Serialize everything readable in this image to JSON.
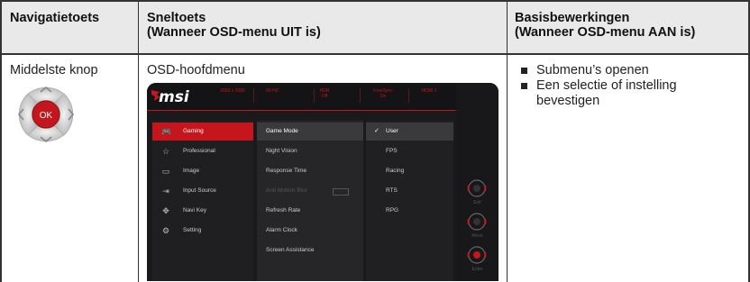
{
  "table": {
    "headers": [
      {
        "line1": "Navigatietoets",
        "line2": ""
      },
      {
        "line1": "Sneltoets",
        "line2": "(Wanneer OSD-menu UIT is)"
      },
      {
        "line1": "Basisbewerkingen",
        "line2": "(Wanneer OSD-menu AAN is)"
      }
    ],
    "row": {
      "key_name": "Middelste knop",
      "key_center_label": "OK",
      "hotkey": "OSD-hoofdmenu",
      "operations": [
        "Submenu’s openen",
        "Een selectie of instelling bevestigen"
      ]
    }
  },
  "osd": {
    "logo": "msi",
    "status": [
      "2560 x 1080",
      "60 HZ",
      "HDR\nOff",
      "FreeSync\nOn",
      "HDMI 1"
    ],
    "menu": [
      {
        "label": "Gaming",
        "icon": "gamepad-icon",
        "selected": true
      },
      {
        "label": "Professional",
        "icon": "star-icon",
        "selected": false
      },
      {
        "label": "Image",
        "icon": "image-icon",
        "selected": false
      },
      {
        "label": "Input Source",
        "icon": "input-icon",
        "selected": false
      },
      {
        "label": "Navi Key",
        "icon": "navi-key-icon",
        "selected": false
      },
      {
        "label": "Setting",
        "icon": "gear-icon",
        "selected": false
      }
    ],
    "submenu": [
      {
        "label": "Game Mode",
        "selected": true
      },
      {
        "label": "Night Vision"
      },
      {
        "label": "Response Time"
      },
      {
        "label": "Anti Motion Blur",
        "dim": true
      },
      {
        "label": "Refresh Rate"
      },
      {
        "label": "Alarm Clock"
      },
      {
        "label": "Screen Assistance"
      }
    ],
    "options": [
      {
        "label": "User",
        "selected": true
      },
      {
        "label": "FPS"
      },
      {
        "label": "Racing"
      },
      {
        "label": "RTS"
      },
      {
        "label": "RPG"
      }
    ],
    "buttons": [
      "Exit",
      "Move",
      "Enter"
    ]
  },
  "colors": {
    "accent": "#c4161c",
    "header_bg": "#e9e9e9"
  }
}
